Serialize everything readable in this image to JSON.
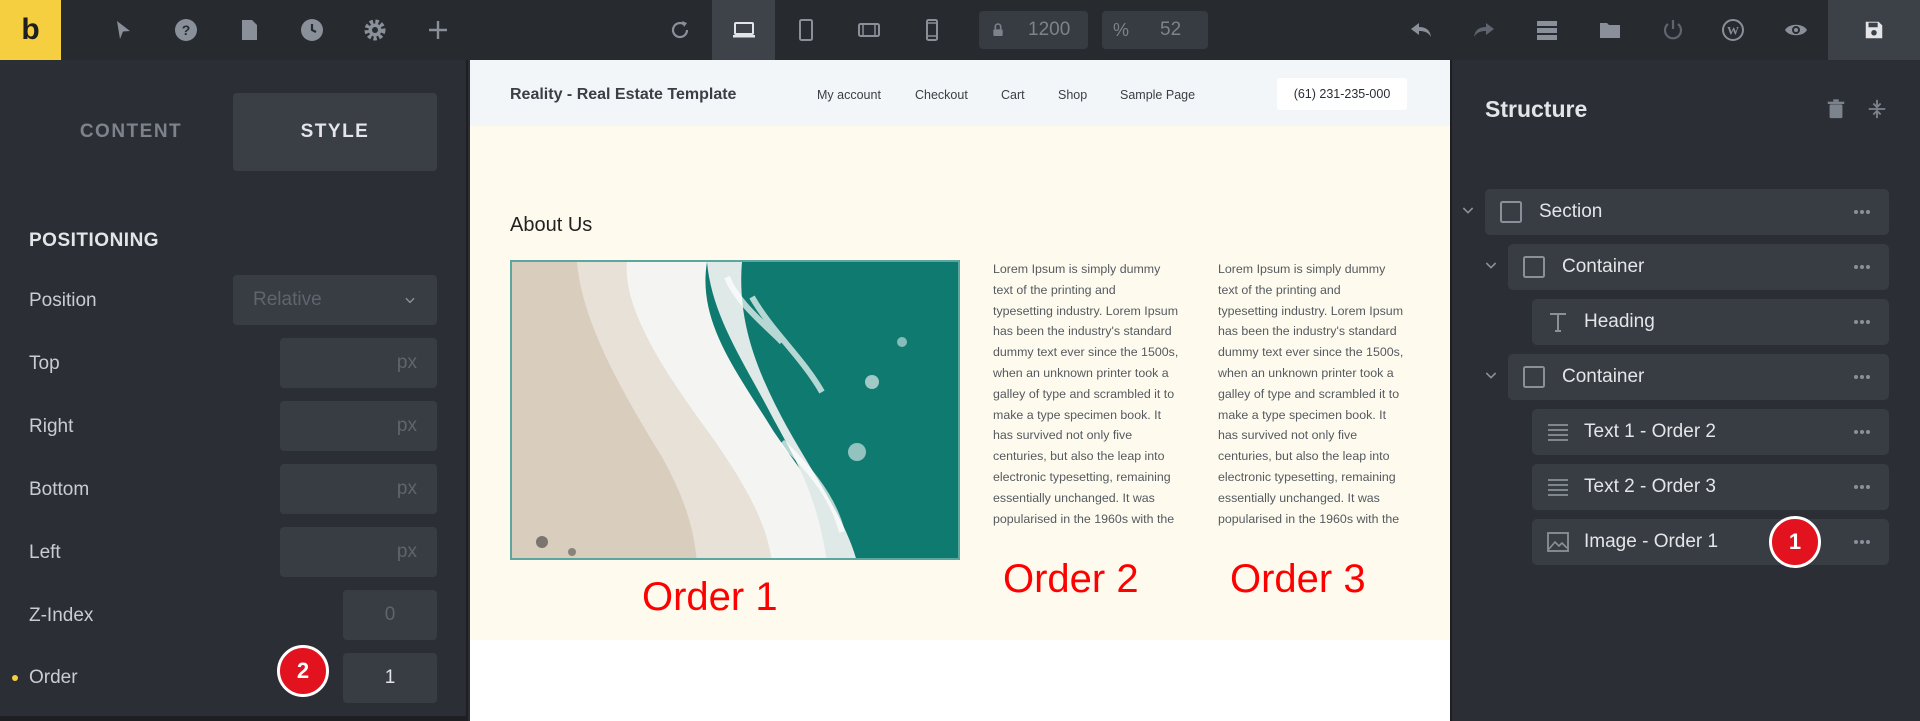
{
  "toolbar": {
    "logo": "b",
    "width_value": "1200",
    "zoom_symbol": "%",
    "zoom_value": "52"
  },
  "left_panel": {
    "tabs": [
      "CONTENT",
      "STYLE"
    ],
    "active_tab": "STYLE",
    "section_title": "POSITIONING",
    "position_label": "Position",
    "position_value": "Relative",
    "fields": [
      {
        "label": "Top",
        "placeholder": "px"
      },
      {
        "label": "Right",
        "placeholder": "px"
      },
      {
        "label": "Bottom",
        "placeholder": "px"
      },
      {
        "label": "Left",
        "placeholder": "px"
      }
    ],
    "zindex_label": "Z-Index",
    "zindex_placeholder": "0",
    "order_label": "Order",
    "order_value": "1",
    "badge": "2"
  },
  "canvas": {
    "site_title": "Reality - Real Estate Template",
    "nav": [
      "My account",
      "Checkout",
      "Cart",
      "Shop",
      "Sample Page"
    ],
    "phone": "(61) 231-235-000",
    "heading": "About Us",
    "text_lines": [
      "Lorem Ipsum is simply dummy",
      "text of the printing and",
      "typesetting industry. Lorem Ipsum",
      "has been the industry's standard",
      "dummy text ever since the 1500s,",
      "when an unknown printer took a",
      "galley of type and scrambled it to",
      "make a type specimen book. It",
      "has survived not only five",
      "centuries, but also the leap into",
      "electronic typesetting, remaining",
      "essentially unchanged. It was",
      "popularised in the 1960s with the"
    ],
    "order_labels": [
      "Order 1",
      "Order 2",
      "Order 3"
    ]
  },
  "structure": {
    "title": "Structure",
    "items": [
      {
        "label": "Section",
        "icon": "square-icon"
      },
      {
        "label": "Container",
        "icon": "square-icon"
      },
      {
        "label": "Heading",
        "icon": "heading-icon"
      },
      {
        "label": "Container",
        "icon": "square-icon"
      },
      {
        "label": "Text 1 - Order 2",
        "icon": "text-lines-icon"
      },
      {
        "label": "Text 2 - Order 3",
        "icon": "text-lines-icon"
      },
      {
        "label": "Image - Order 1",
        "icon": "image-icon"
      }
    ],
    "badge": "1"
  },
  "colors": {
    "accent": "#f5cf3f",
    "badge": "#e3121f",
    "order_text": "#ff0000",
    "panel_bg": "#2b2f35"
  }
}
